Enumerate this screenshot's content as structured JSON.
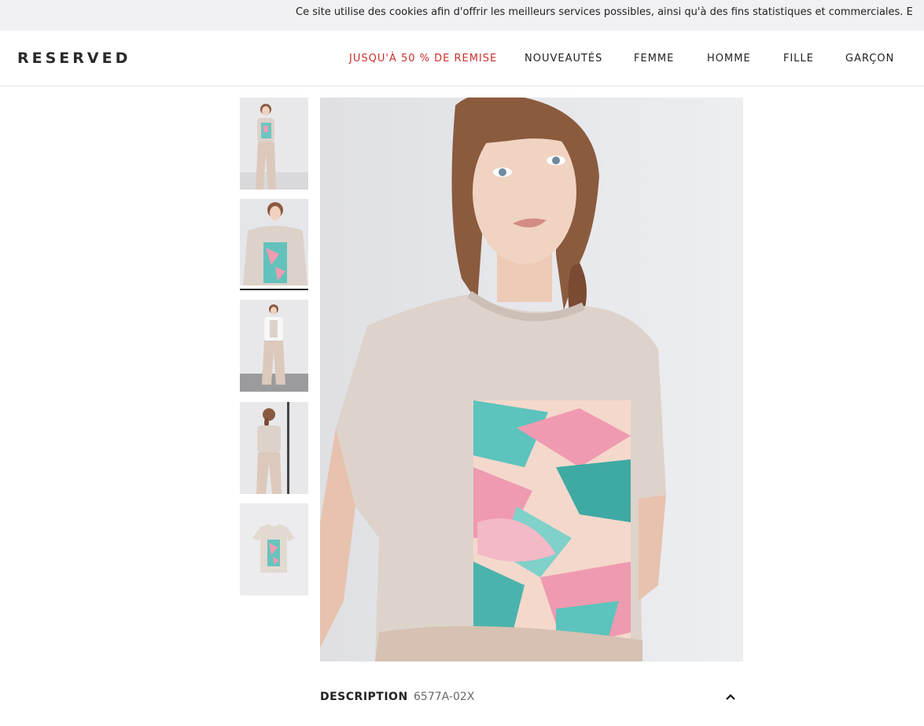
{
  "cookie_bar": {
    "text": "Ce site utilise des cookies afin d'offrir les meilleurs services possibles, ainsi qu'à des fins statistiques et commerciales. E"
  },
  "header": {
    "logo": "RESERVED",
    "nav": [
      {
        "label": "JUSQU'À 50 % DE REMISE",
        "color": "#c9302c"
      },
      {
        "label": "NOUVEAUTÉS"
      },
      {
        "label": "FEMME"
      },
      {
        "label": "HOMME"
      },
      {
        "label": "FILLE"
      },
      {
        "label": "GARÇON"
      }
    ]
  },
  "gallery": {
    "thumbnails": [
      {
        "view": "front-full"
      },
      {
        "view": "front-closeup",
        "selected": true
      },
      {
        "view": "with-jacket"
      },
      {
        "view": "back"
      },
      {
        "view": "flat-product"
      }
    ],
    "main_image": {
      "view": "front-closeup"
    }
  },
  "description": {
    "label": "DESCRIPTION",
    "code": "6577A-02X",
    "icon": "chevron-up-icon"
  },
  "colors": {
    "sale": "#c9302c",
    "tshirt": "#ddd3cb",
    "print_teal": "#5cc3bd",
    "print_pink": "#ef9ab0"
  }
}
